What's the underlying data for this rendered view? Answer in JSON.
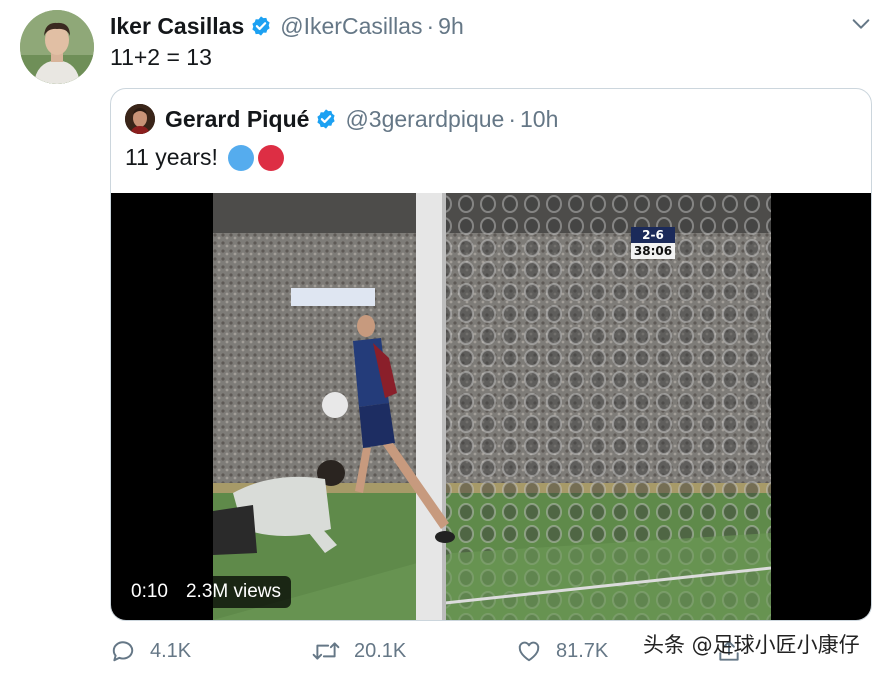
{
  "tweet": {
    "author_name": "Iker Casillas",
    "handle": "@IkerCasillas",
    "separator": "·",
    "time": "9h",
    "text": "11+2 = 13"
  },
  "quoted_tweet": {
    "author_name": "Gerard Piqué",
    "handle": "@3gerardpique",
    "separator": "·",
    "time": "10h",
    "text": "11 years!",
    "emojis": [
      "blue-circle",
      "red-circle"
    ]
  },
  "video": {
    "duration": "0:10",
    "views": "2.3M views",
    "score": "2-6",
    "match_clock": "38:06"
  },
  "actions": {
    "replies": "4.1K",
    "retweets": "20.1K",
    "likes": "81.7K"
  },
  "watermark": "头条 @足球小匠小康仔",
  "colors": {
    "verified": "#1da1f2",
    "secondary_text": "#657786",
    "border": "#ccd6dd",
    "emoji_blue": "#55acee",
    "emoji_red": "#dd2e44"
  }
}
